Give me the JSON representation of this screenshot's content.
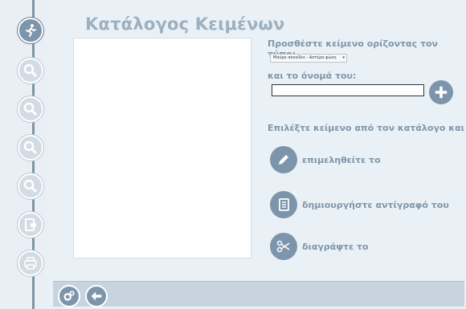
{
  "title": "Κατάλογος Κειμένων",
  "type_prompt": "Προσθέστε κείμενο ορίζοντας τον τύπο:",
  "type_select_value": "Μαύρο σκονίδιο - Αστέρα φώνη",
  "name_prompt": "και το όνομά του:",
  "name_value": "",
  "choose_prompt": "Επιλέξτε κείμενο από τον κατάλογο και",
  "actions": {
    "edit": "επιμεληθείτε το",
    "copy": "δημιουργήστε αντίγραφό του",
    "delete": "διαγράψτε το"
  },
  "sidebar": {
    "items": [
      "run-icon",
      "search-icon",
      "search-icon",
      "search-icon",
      "search-icon",
      "export-icon",
      "print-icon"
    ]
  },
  "bottom_bar": {
    "items": [
      "settings-icon",
      "back-icon"
    ]
  },
  "colors": {
    "accent": "#7d95ab",
    "title": "#9db0c0",
    "label": "#7e95a9"
  }
}
